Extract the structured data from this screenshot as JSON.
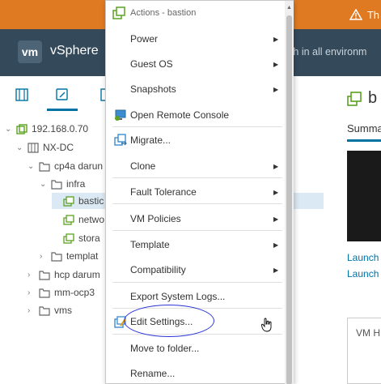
{
  "alert": {
    "text": "Th"
  },
  "header": {
    "logo": "vm",
    "product": "vSphere",
    "search_placeholder": "rch in all environm"
  },
  "nav_tabs": [
    "hosts-clusters-icon",
    "vms-templates-icon",
    "storage-icon"
  ],
  "tree": [
    {
      "label": "192.168.0.70",
      "icon": "vcenter-icon",
      "expanded": true
    },
    {
      "label": "NX-DC",
      "icon": "datacenter-icon",
      "expanded": true
    },
    {
      "label": "cp4a darun",
      "icon": "folder-icon",
      "expanded": true
    },
    {
      "label": "infra",
      "icon": "folder-icon",
      "expanded": true
    },
    {
      "label": "bastic",
      "icon": "vm-icon",
      "selected": true
    },
    {
      "label": "netwo",
      "icon": "vm-icon"
    },
    {
      "label": "stora",
      "icon": "vm-icon"
    },
    {
      "label": "templat",
      "icon": "folder-icon",
      "expanded": false
    },
    {
      "label": "hcp darum",
      "icon": "folder-icon",
      "expanded": false
    },
    {
      "label": "mm-ocp3",
      "icon": "folder-icon",
      "expanded": false
    },
    {
      "label": "vms",
      "icon": "folder-icon",
      "expanded": false
    }
  ],
  "right_pane": {
    "title": "b",
    "summary_tab": "Summa",
    "launch_links": [
      "Launch",
      "Launch"
    ],
    "vm_hardware_label": "VM H"
  },
  "menu": {
    "header": "Actions - bastion",
    "items": [
      {
        "label": "Power",
        "submenu": true
      },
      {
        "label": "Guest OS",
        "submenu": true
      },
      {
        "label": "Snapshots",
        "submenu": true
      },
      {
        "label": "Open Remote Console",
        "icon": "remote-console-icon"
      },
      {
        "label": "Migrate...",
        "icon": "migrate-icon"
      },
      {
        "label": "Clone",
        "submenu": true
      },
      {
        "label": "Fault Tolerance",
        "submenu": true
      },
      {
        "label": "VM Policies",
        "submenu": true
      },
      {
        "label": "Template",
        "submenu": true
      },
      {
        "label": "Compatibility",
        "submenu": true
      },
      {
        "label": "Export System Logs..."
      },
      {
        "label": "Edit Settings...",
        "icon": "edit-settings-icon",
        "highlighted": true
      },
      {
        "label": "Move to folder..."
      },
      {
        "label": "Rename..."
      }
    ]
  },
  "colors": {
    "alert": "#e07a22",
    "header": "#344a5b",
    "accent": "#0072a3",
    "annotation": "#2a35d8"
  }
}
